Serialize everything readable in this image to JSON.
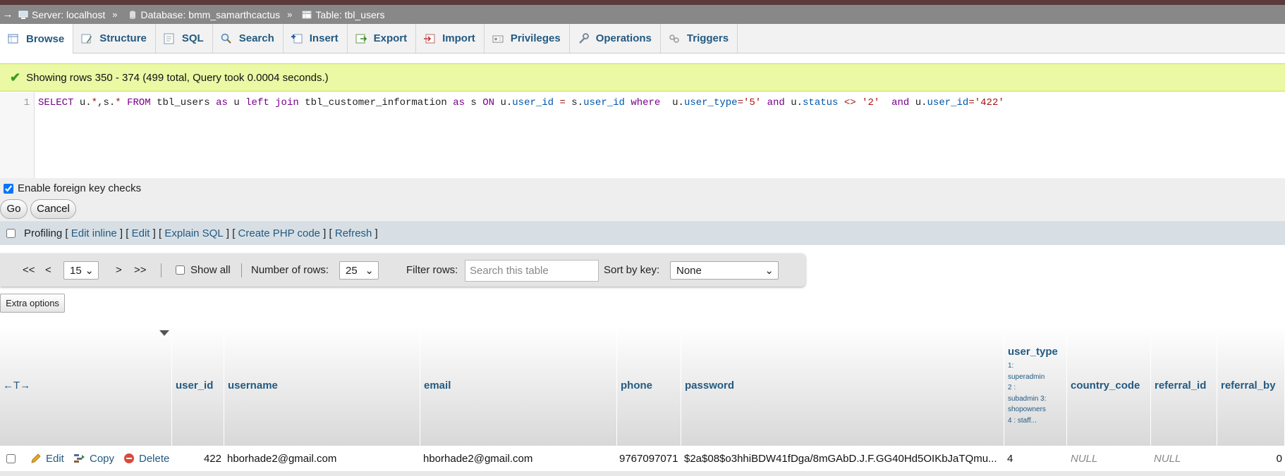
{
  "breadcrumb": {
    "server": "Server: localhost",
    "database": "Database: bmm_samarthcactus",
    "table": "Table: tbl_users",
    "separator": "»",
    "back_arrow": "→"
  },
  "tabs": [
    {
      "label": "Browse",
      "icon": "browse-icon"
    },
    {
      "label": "Structure",
      "icon": "structure-icon"
    },
    {
      "label": "SQL",
      "icon": "sql-icon"
    },
    {
      "label": "Search",
      "icon": "search-icon"
    },
    {
      "label": "Insert",
      "icon": "insert-icon"
    },
    {
      "label": "Export",
      "icon": "export-icon"
    },
    {
      "label": "Import",
      "icon": "import-icon"
    },
    {
      "label": "Privileges",
      "icon": "privileges-icon"
    },
    {
      "label": "Operations",
      "icon": "operations-icon"
    },
    {
      "label": "Triggers",
      "icon": "triggers-icon"
    }
  ],
  "message": {
    "text": "Showing rows 350 - 374 (499 total, Query took 0.0004 seconds.)"
  },
  "query": {
    "line_number": "1",
    "tokens": [
      {
        "t": "SELECT",
        "c": "kw"
      },
      {
        "t": " u.",
        "c": ""
      },
      {
        "t": "*",
        "c": "op"
      },
      {
        "t": ",s.",
        "c": ""
      },
      {
        "t": "*",
        "c": "op"
      },
      {
        "t": " FROM",
        "c": "kw"
      },
      {
        "t": " tbl_users ",
        "c": ""
      },
      {
        "t": "as",
        "c": "kw"
      },
      {
        "t": " u ",
        "c": ""
      },
      {
        "t": "left join",
        "c": "kw"
      },
      {
        "t": " tbl_customer_information ",
        "c": ""
      },
      {
        "t": "as",
        "c": "kw"
      },
      {
        "t": " s ",
        "c": ""
      },
      {
        "t": "ON",
        "c": "kw"
      },
      {
        "t": " u.",
        "c": ""
      },
      {
        "t": "user_id",
        "c": "col"
      },
      {
        "t": " = ",
        "c": "op"
      },
      {
        "t": "s.",
        "c": ""
      },
      {
        "t": "user_id",
        "c": "col"
      },
      {
        "t": " where",
        "c": "kw"
      },
      {
        "t": "  u.",
        "c": ""
      },
      {
        "t": "user_type",
        "c": "col"
      },
      {
        "t": "=",
        "c": "op"
      },
      {
        "t": "'5'",
        "c": "str"
      },
      {
        "t": " and",
        "c": "kw"
      },
      {
        "t": " u.",
        "c": ""
      },
      {
        "t": "status",
        "c": "col"
      },
      {
        "t": " <> ",
        "c": "op"
      },
      {
        "t": "'2'",
        "c": "str"
      },
      {
        "t": "  and",
        "c": "kw"
      },
      {
        "t": " u.",
        "c": ""
      },
      {
        "t": "user_id",
        "c": "col"
      },
      {
        "t": "=",
        "c": "op"
      },
      {
        "t": "'422'",
        "c": "str"
      }
    ]
  },
  "options": {
    "fk_checks_label": "Enable foreign key checks",
    "fk_checks_checked": true,
    "go_label": "Go",
    "cancel_label": "Cancel"
  },
  "profiling": {
    "label": "Profiling",
    "checked": false,
    "links": [
      "Edit inline",
      "Edit",
      "Explain SQL",
      "Create PHP code",
      "Refresh"
    ]
  },
  "navigation": {
    "first": "<<",
    "prev": "<",
    "page": "15",
    "next": ">",
    "last": ">>",
    "show_all": "Show all",
    "rows_label": "Number of rows:",
    "rows_value": "25",
    "filter_label": "Filter rows:",
    "filter_placeholder": "Search this table",
    "sort_label": "Sort by key:",
    "sort_value": "None"
  },
  "extra_options": "Extra options",
  "table": {
    "move_arrows": "←T→",
    "columns": [
      "user_id",
      "username",
      "email",
      "phone",
      "password",
      "user_type",
      "country_code",
      "referral_id",
      "referral_by"
    ],
    "user_type_comment": [
      "1:",
      "superadmin",
      "2 :",
      "subadmin 3:",
      "shopowners",
      "4 : staff..."
    ],
    "row_actions": {
      "edit": "Edit",
      "copy": "Copy",
      "delete": "Delete"
    },
    "rows": [
      {
        "user_id": "422",
        "username": "hborhade2@gmail.com",
        "email": "hborhade2@gmail.com",
        "phone": "9767097071",
        "password": "$2a$08$o3hhiBDW41fDga/8mGAbD.J.F.GG40Hd5OIKbJaTQmu...",
        "user_type": "4",
        "country_code": "NULL",
        "referral_id": "NULL",
        "referral_by": "0"
      }
    ]
  }
}
